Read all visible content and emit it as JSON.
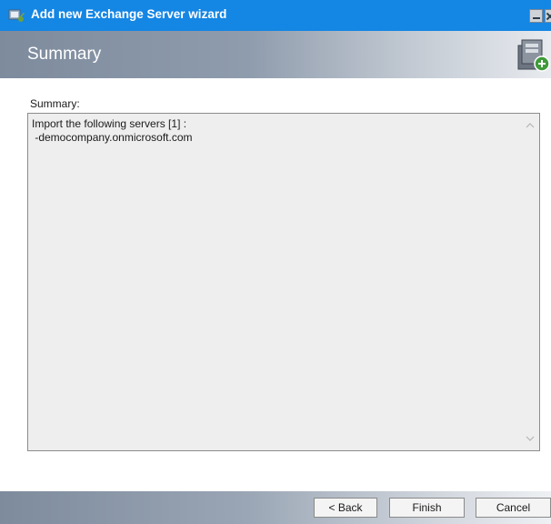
{
  "window": {
    "title": "Add new Exchange Server wizard",
    "icon": "wizard-app-icon"
  },
  "header": {
    "title": "Summary",
    "icon": "server-add-icon"
  },
  "summary": {
    "label": "Summary:",
    "text": "Import the following servers [1] :\n -democompany.onmicrosoft.com"
  },
  "buttons": {
    "back": "< Back",
    "finish": "Finish",
    "cancel": "Cancel"
  },
  "colors": {
    "titlebar": "#1486e4",
    "header_band": "#8f9cad",
    "text_area_bg": "#eeeeee"
  }
}
